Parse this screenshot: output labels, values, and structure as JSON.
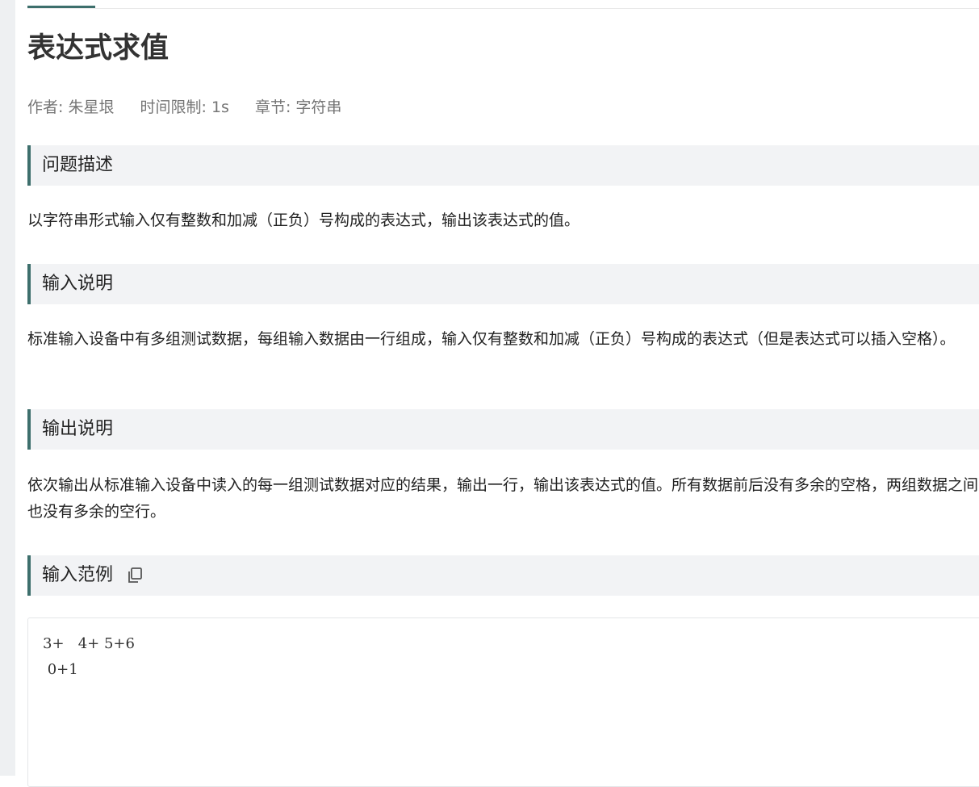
{
  "problem": {
    "title": "表达式求值",
    "meta": {
      "author": "作者: 朱星垠",
      "time_limit": "时间限制: 1s",
      "chapter": "章节: 字符串"
    }
  },
  "sections": {
    "description": {
      "title": "问题描述",
      "text": "以字符串形式输入仅有整数和加减（正负）号构成的表达式，输出该表达式的值。"
    },
    "input": {
      "title": "输入说明",
      "text": "标准输入设备中有多组测试数据，每组输入数据由一行组成，输入仅有整数和加减（正负）号构成的表达式（但是表达式可以插入空格）。"
    },
    "output": {
      "title": "输出说明",
      "text": "依次输出从标准输入设备中读入的每一组测试数据对应的结果，输出一行，输出该表达式的值。所有数据前后没有多余的空格，两组数据之间也没有多余的空行。"
    },
    "sample_input": {
      "title": "输入范例",
      "icon": "copy-icon",
      "lines": [
        "3+   4+ 5+6",
        " 0+1"
      ]
    }
  },
  "colors": {
    "accent": "#3d6f6c",
    "section_bg": "#f2f3f5",
    "meta_text": "#757575"
  }
}
